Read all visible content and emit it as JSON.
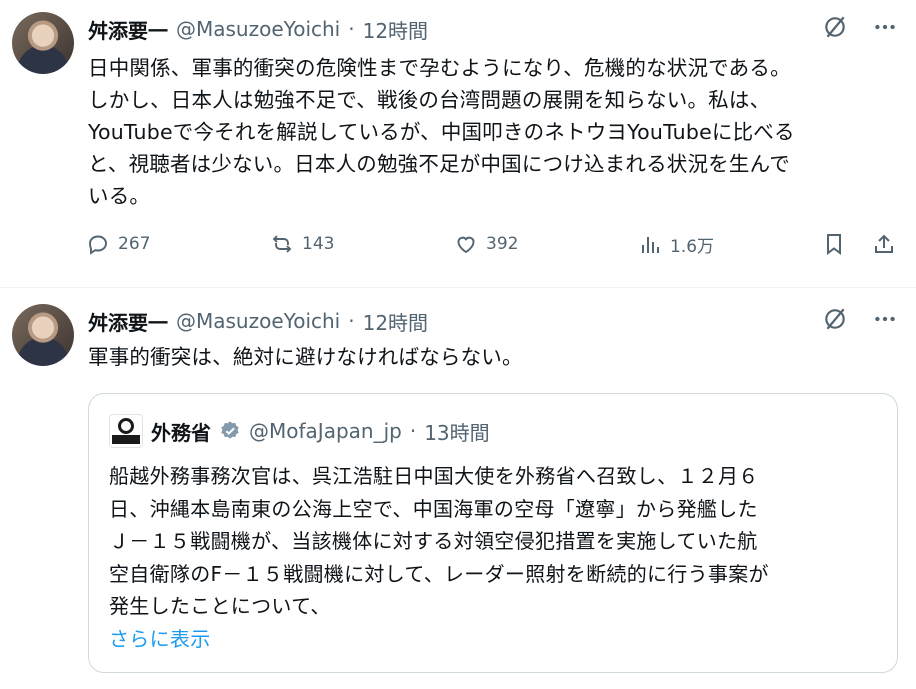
{
  "tweets": [
    {
      "display_name": "舛添要一",
      "handle": "@MasuzoeYoichi",
      "separator": "·",
      "time": "12時間",
      "text_lines": [
        "日中関係、軍事的衝突の危険性まで孕むようになり、危機的な状況である。",
        "しかし、日本人は勉強不足で、戦後の台湾問題の展開を知らない。私は、",
        "YouTubeで今それを解説しているが、中国叩きのネトウヨYouTubeに比べる",
        "と、視聴者は少ない。日本人の勉強不足が中国につけ込まれる状況を生んで",
        "いる。"
      ],
      "stats": {
        "replies": "267",
        "reposts": "143",
        "likes": "392",
        "views": "1.6万"
      }
    },
    {
      "display_name": "舛添要一",
      "handle": "@MasuzoeYoichi",
      "separator": "·",
      "time": "12時間",
      "text": "軍事的衝突は、絶対に避けなければならない。",
      "quote": {
        "display_name": "外務省",
        "handle": "@MofaJapan_jp",
        "separator": "·",
        "time": "13時間",
        "logo_text": "外務省",
        "text_lines": [
          "船越外務事務次官は、呉江浩駐日中国大使を外務省へ召致し、１２月６",
          "日、沖縄本島南東の公海上空で、中国海軍の空母「遼寧」から発艦した",
          "Ｊ－１５戦闘機が、当該機体に対する対領空侵犯措置を実施していた航",
          "空自衛隊のF－１５戦闘機に対して、レーダー照射を断続的に行う事案が",
          "発生したことについて、"
        ],
        "show_more": "さらに表示"
      }
    }
  ],
  "icons": {
    "grok": "grok-icon",
    "more": "more-icon",
    "reply": "reply-icon",
    "repost": "repost-icon",
    "like": "like-icon",
    "views": "views-icon",
    "bookmark": "bookmark-icon",
    "share": "share-icon",
    "verified": "verified-badge-icon"
  },
  "colors": {
    "text": "#0f1419",
    "secondary": "#536471",
    "link": "#1d9bf0",
    "border": "#cfd9de",
    "verified": "#829aab"
  }
}
